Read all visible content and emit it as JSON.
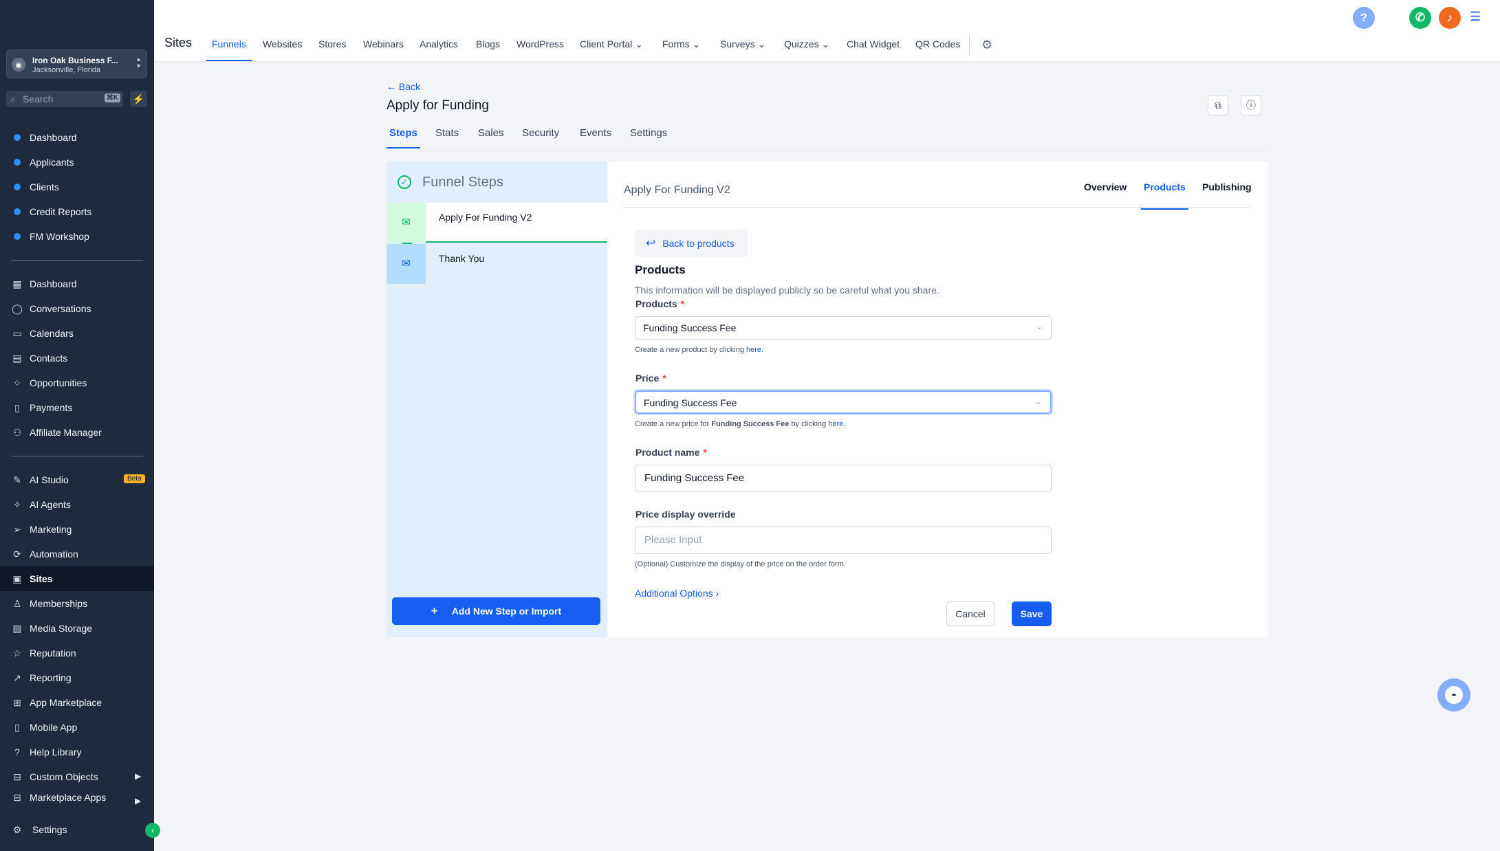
{
  "account": {
    "name": "Iron Oak Business F...",
    "location": "Jacksonville, Florida"
  },
  "search": {
    "placeholder": "Search",
    "shortcut": "⌘K"
  },
  "sidebar": {
    "group1": [
      {
        "label": "Dashboard"
      },
      {
        "label": "Applicants"
      },
      {
        "label": "Clients"
      },
      {
        "label": "Credit Reports"
      },
      {
        "label": "FM Workshop"
      }
    ],
    "group2": [
      {
        "label": "Dashboard",
        "icon": "grid-icon"
      },
      {
        "label": "Conversations",
        "icon": "chat-icon"
      },
      {
        "label": "Calendars",
        "icon": "calendar-icon"
      },
      {
        "label": "Contacts",
        "icon": "contacts-icon"
      },
      {
        "label": "Opportunities",
        "icon": "opportunities-icon"
      },
      {
        "label": "Payments",
        "icon": "payments-icon"
      },
      {
        "label": "Affiliate Manager",
        "icon": "affiliate-icon"
      }
    ],
    "group3": [
      {
        "label": "AI Studio",
        "badge": "Beta"
      },
      {
        "label": "AI Agents"
      },
      {
        "label": "Marketing"
      },
      {
        "label": "Automation"
      },
      {
        "label": "Sites",
        "selected": true
      },
      {
        "label": "Memberships"
      },
      {
        "label": "Media Storage"
      },
      {
        "label": "Reputation"
      },
      {
        "label": "Reporting"
      },
      {
        "label": "App Marketplace"
      },
      {
        "label": "Mobile App"
      },
      {
        "label": "Help Library"
      },
      {
        "label": "Custom Objects"
      },
      {
        "label": "Marketplace Apps"
      }
    ],
    "settings": "Settings"
  },
  "topbar": {
    "title": "Sites",
    "links": [
      "Funnels",
      "Websites",
      "Stores",
      "Webinars",
      "Analytics",
      "Blogs",
      "WordPress",
      "Client Portal",
      "Forms",
      "Surveys",
      "Quizzes",
      "Chat Widget",
      "QR Codes"
    ],
    "help_icon": "?",
    "colors": {
      "phone": "#12b76a",
      "bell": "#ef6820",
      "help": "#84adff"
    }
  },
  "page": {
    "back": "Back",
    "title": "Apply for Funding",
    "tabs": [
      "Steps",
      "Stats",
      "Sales",
      "Security",
      "Events",
      "Settings"
    ]
  },
  "funnel_steps": {
    "heading": "Funnel Steps",
    "steps": [
      "Apply For Funding V2",
      "Thank You"
    ],
    "add_button": "Add New Step or Import"
  },
  "panel": {
    "title": "Apply For Funding V2",
    "tabs": [
      "Overview",
      "Products",
      "Publishing"
    ],
    "back_to_products": "Back to products",
    "section_title": "Products",
    "section_desc": "This information will be displayed publicly so be careful what you share.",
    "products_label": "Products",
    "products_value": "Funding Success Fee",
    "products_hint_pre": "Create a new product by clicking ",
    "here": "here.",
    "price_label": "Price",
    "price_value": "Funding Success Fee",
    "price_hint_pre": "Create a new price for ",
    "price_hint_bold": "Funding Success Fee",
    "price_hint_mid": " by clicking ",
    "product_name_label": "Product name",
    "product_name_value": "Funding Success Fee",
    "price_override_label": "Price display override",
    "price_override_placeholder": "Please Input",
    "price_override_hint": "(Optional) Customize the display of the price on the order form.",
    "additional_options": "Additional Options",
    "cancel": "Cancel",
    "save": "Save"
  }
}
